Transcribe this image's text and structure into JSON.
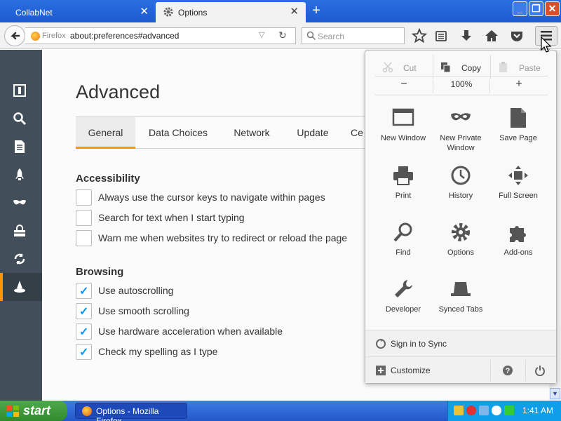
{
  "browser": {
    "tabs": [
      {
        "title": "CollabNet",
        "active": false
      },
      {
        "title": "Options",
        "active": true
      }
    ],
    "url_brand": "Firefox",
    "url": "about:preferences#advanced",
    "search_placeholder": "Search"
  },
  "sidebar": {
    "items": [
      {
        "icon": "general-icon"
      },
      {
        "icon": "search-icon"
      },
      {
        "icon": "content-icon"
      },
      {
        "icon": "applications-icon"
      },
      {
        "icon": "privacy-icon"
      },
      {
        "icon": "security-icon"
      },
      {
        "icon": "sync-icon"
      },
      {
        "icon": "advanced-icon",
        "selected": true
      }
    ]
  },
  "main": {
    "title": "Advanced",
    "tabs": [
      "General",
      "Data Choices",
      "Network",
      "Update",
      "Ce"
    ],
    "accessibility": {
      "heading": "Accessibility",
      "options": [
        {
          "label": "Always use the cursor keys to navigate within pages",
          "checked": false
        },
        {
          "label": "Search for text when I start typing",
          "checked": false
        },
        {
          "label": "Warn me when websites try to redirect or reload the page",
          "checked": false
        }
      ]
    },
    "browsing": {
      "heading": "Browsing",
      "options": [
        {
          "label": "Use autoscrolling",
          "checked": true
        },
        {
          "label": "Use smooth scrolling",
          "checked": true
        },
        {
          "label": "Use hardware acceleration when available",
          "checked": true
        },
        {
          "label": "Check my spelling as I type",
          "checked": true
        }
      ]
    }
  },
  "panel": {
    "edit": {
      "cut": "Cut",
      "copy": "Copy",
      "paste": "Paste"
    },
    "zoom": {
      "minus": "−",
      "value": "100%",
      "plus": "+"
    },
    "items": [
      {
        "label": "New Window",
        "icon": "new-window-icon"
      },
      {
        "label": "New Private Window",
        "icon": "private-window-icon"
      },
      {
        "label": "Save Page",
        "icon": "save-page-icon"
      },
      {
        "label": "Print",
        "icon": "print-icon"
      },
      {
        "label": "History",
        "icon": "history-icon"
      },
      {
        "label": "Full Screen",
        "icon": "fullscreen-icon"
      },
      {
        "label": "Find",
        "icon": "find-icon"
      },
      {
        "label": "Options",
        "icon": "options-icon"
      },
      {
        "label": "Add-ons",
        "icon": "addons-icon"
      },
      {
        "label": "Developer",
        "icon": "developer-icon"
      },
      {
        "label": "Synced Tabs",
        "icon": "synced-tabs-icon"
      }
    ],
    "sign_in": "Sign in to Sync",
    "customize": "Customize"
  },
  "taskbar": {
    "start": "start",
    "task": "Options - Mozilla Firefox",
    "clock": "1:41 AM"
  }
}
